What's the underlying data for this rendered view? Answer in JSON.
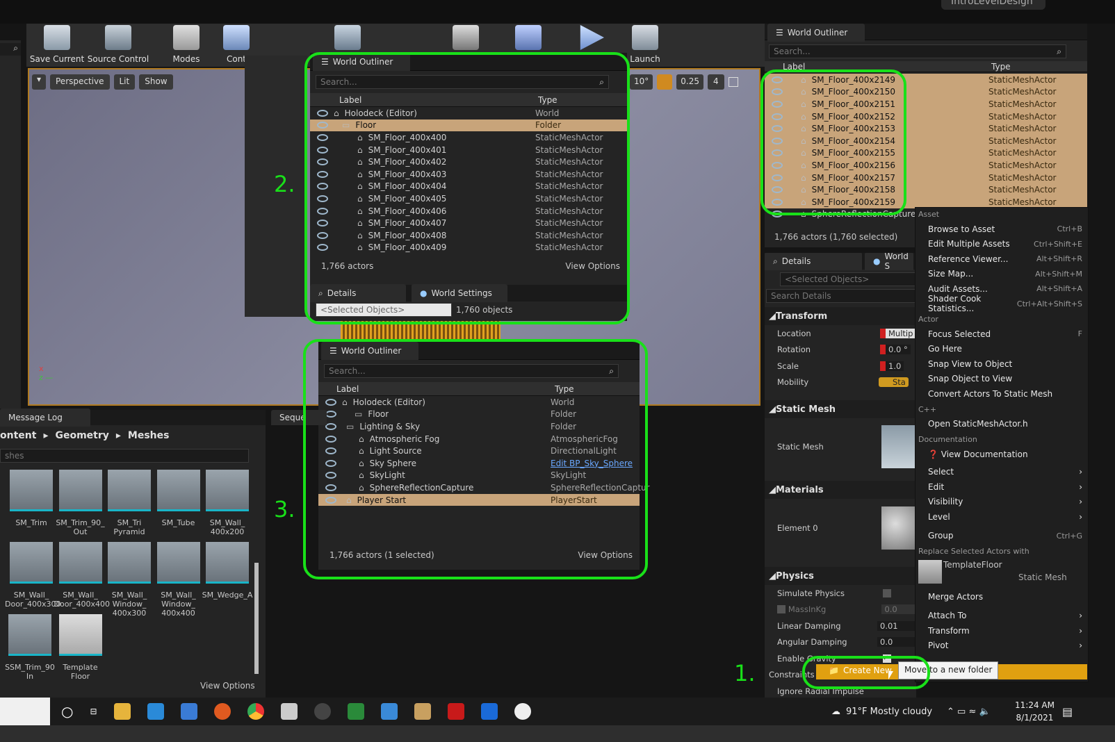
{
  "window_title": "IntroLevelDesign",
  "toolbar": {
    "items": [
      {
        "label": "Save Current"
      },
      {
        "label": "Source Control"
      },
      {
        "label": "Modes"
      },
      {
        "label": "Cont"
      },
      {
        "label": "Launch"
      }
    ]
  },
  "viewport": {
    "perspective": "Perspective",
    "lit": "Lit",
    "show": "Show",
    "snap_angle": "10°",
    "snap_scale": "0.25",
    "cam_speed": "4",
    "cam_speed_small": "4"
  },
  "outliner_main": {
    "title": "World Outliner",
    "search_placeholder": "Search...",
    "col_label": "Label",
    "col_type": "Type",
    "rows": [
      {
        "label": "SM_Floor_400x2149",
        "type": "StaticMeshActor"
      },
      {
        "label": "SM_Floor_400x2150",
        "type": "StaticMeshActor"
      },
      {
        "label": "SM_Floor_400x2151",
        "type": "StaticMeshActor"
      },
      {
        "label": "SM_Floor_400x2152",
        "type": "StaticMeshActor"
      },
      {
        "label": "SM_Floor_400x2153",
        "type": "StaticMeshActor"
      },
      {
        "label": "SM_Floor_400x2154",
        "type": "StaticMeshActor"
      },
      {
        "label": "SM_Floor_400x2155",
        "type": "StaticMeshActor"
      },
      {
        "label": "SM_Floor_400x2156",
        "type": "StaticMeshActor"
      },
      {
        "label": "SM_Floor_400x2157",
        "type": "StaticMeshActor"
      },
      {
        "label": "SM_Floor_400x2158",
        "type": "StaticMeshActor"
      },
      {
        "label": "SM_Floor_400x2159",
        "type": "StaticMeshActor"
      },
      {
        "label": "SphereReflectionCapture",
        "type": ""
      }
    ],
    "status": "1,766 actors (1,760 selected)"
  },
  "details_main": {
    "tab_details": "Details",
    "tab_world": "World S",
    "selected_placeholder": "<Selected Objects>",
    "search_placeholder": "Search Details",
    "transform": "Transform",
    "location": "Location",
    "location_val": "Multip",
    "rotation": "Rotation",
    "rotation_val": "0.0 °",
    "scale": "Scale",
    "scale_val": "1.0",
    "mobility": "Mobility",
    "mobility_val": "Sta",
    "static_mesh_section": "Static Mesh",
    "static_mesh": "Static Mesh",
    "materials": "Materials",
    "element0": "Element 0",
    "physics": "Physics",
    "simulate_physics": "Simulate Physics",
    "mass": "MassInKg",
    "mass_val": "0.0",
    "linear_damping": "Linear Damping",
    "linear_val": "0.01",
    "angular_damping": "Angular Damping",
    "angular_val": "0.0",
    "enable_gravity": "Enable Gravity",
    "constraints": "Constraints",
    "ignore_radial": "Ignore Radial Impulse"
  },
  "context_menu": {
    "asset_header": "Asset",
    "asset_items": [
      {
        "label": "Browse to Asset",
        "shortcut": "Ctrl+B"
      },
      {
        "label": "Edit Multiple Assets",
        "shortcut": "Ctrl+Shift+E"
      },
      {
        "label": "Reference Viewer...",
        "shortcut": "Alt+Shift+R"
      },
      {
        "label": "Size Map...",
        "shortcut": "Alt+Shift+M"
      },
      {
        "label": "Audit Assets...",
        "shortcut": "Alt+Shift+A"
      },
      {
        "label": "Shader Cook Statistics...",
        "shortcut": "Ctrl+Alt+Shift+S"
      }
    ],
    "actor_header": "Actor",
    "actor_items": [
      {
        "label": "Focus Selected",
        "shortcut": "F"
      },
      {
        "label": "Go Here",
        "shortcut": ""
      },
      {
        "label": "Snap View to Object",
        "shortcut": ""
      },
      {
        "label": "Snap Object to View",
        "shortcut": ""
      },
      {
        "label": "Convert Actors To Static Mesh",
        "shortcut": ""
      }
    ],
    "cpp_header": "C++",
    "cpp_item": "Open StaticMeshActor.h",
    "doc_header": "Documentation",
    "doc_item": "View Documentation",
    "sub_items": [
      {
        "label": "Select"
      },
      {
        "label": "Edit"
      },
      {
        "label": "Visibility"
      },
      {
        "label": "Level"
      }
    ],
    "group": "Group",
    "group_shortcut": "Ctrl+G",
    "replace_header": "Replace Selected Actors with",
    "replace_name": "TemplateFloor",
    "replace_type": "Static Mesh",
    "merge": "Merge Actors",
    "sub_items2": [
      {
        "label": "Attach To"
      },
      {
        "label": "Transform"
      },
      {
        "label": "Pivot"
      }
    ],
    "create_new": "Create New Folder",
    "create_new_visible": "Create New",
    "tooltip": "Move to a new folder"
  },
  "outliner2": {
    "title": "World Outliner",
    "search_placeholder": "Search...",
    "col_label": "Label",
    "col_type": "Type",
    "rows": [
      {
        "label": "Holodeck (Editor)",
        "type": "World"
      },
      {
        "label": "Floor",
        "type": "Folder"
      },
      {
        "label": "SM_Floor_400x400",
        "type": "StaticMeshActor"
      },
      {
        "label": "SM_Floor_400x401",
        "type": "StaticMeshActor"
      },
      {
        "label": "SM_Floor_400x402",
        "type": "StaticMeshActor"
      },
      {
        "label": "SM_Floor_400x403",
        "type": "StaticMeshActor"
      },
      {
        "label": "SM_Floor_400x404",
        "type": "StaticMeshActor"
      },
      {
        "label": "SM_Floor_400x405",
        "type": "StaticMeshActor"
      },
      {
        "label": "SM_Floor_400x406",
        "type": "StaticMeshActor"
      },
      {
        "label": "SM_Floor_400x407",
        "type": "StaticMeshActor"
      },
      {
        "label": "SM_Floor_400x408",
        "type": "StaticMeshActor"
      },
      {
        "label": "SM_Floor_400x409",
        "type": "StaticMeshActor"
      }
    ],
    "status": "1,766 actors",
    "view_options": "View Options",
    "tab_details": "Details",
    "tab_world_settings": "World Settings",
    "selected_placeholder": "<Selected Objects>",
    "objects": "1,760 objects"
  },
  "outliner3": {
    "title": "World Outliner",
    "search_placeholder": "Search...",
    "col_label": "Label",
    "col_type": "Type",
    "rows": [
      {
        "label": "Holodeck (Editor)",
        "type": "World"
      },
      {
        "label": "Floor",
        "type": "Folder"
      },
      {
        "label": "Lighting & Sky",
        "type": "Folder"
      },
      {
        "label": "Atmospheric Fog",
        "type": "AtmosphericFog"
      },
      {
        "label": "Light Source",
        "type": "DirectionalLight"
      },
      {
        "label": "Sky Sphere",
        "type": "Edit BP_Sky_Sphere"
      },
      {
        "label": "SkyLight",
        "type": "SkyLight"
      },
      {
        "label": "SphereReflectionCapture",
        "type": "SphereReflectionCaptur"
      },
      {
        "label": "Player Start",
        "type": "PlayerStart"
      }
    ],
    "status": "1,766 actors (1 selected)",
    "view_options": "View Options"
  },
  "steps": {
    "one": "1.",
    "two": "2.",
    "three": "3."
  },
  "content_browser": {
    "tab": "Message Log",
    "seq_tab": "Seque",
    "breadcrumb": [
      "ontent",
      "Geometry",
      "Meshes"
    ],
    "search_placeholder": "shes",
    "view_options": "View Options",
    "assets": [
      {
        "label": "SM_Trim"
      },
      {
        "label": "SM_Trim_90_ Out"
      },
      {
        "label": "SM_Tri Pyramid"
      },
      {
        "label": "SM_Tube"
      },
      {
        "label": "SM_Wall_ 400x200"
      },
      {
        "label": "SM_Wall_ Door_400x300"
      },
      {
        "label": "SM_Wall_ Door_400x400"
      },
      {
        "label": "SM_Wall_ Window_ 400x300"
      },
      {
        "label": "SM_Wall_ Window_ 400x400"
      },
      {
        "label": "SM_Wedge_A"
      },
      {
        "label": "SSM_Trim_90 In"
      },
      {
        "label": "Template Floor"
      }
    ]
  },
  "taskbar": {
    "weather": "91°F Mostly cloudy",
    "time": "11:24 AM",
    "date": "8/1/2021"
  }
}
